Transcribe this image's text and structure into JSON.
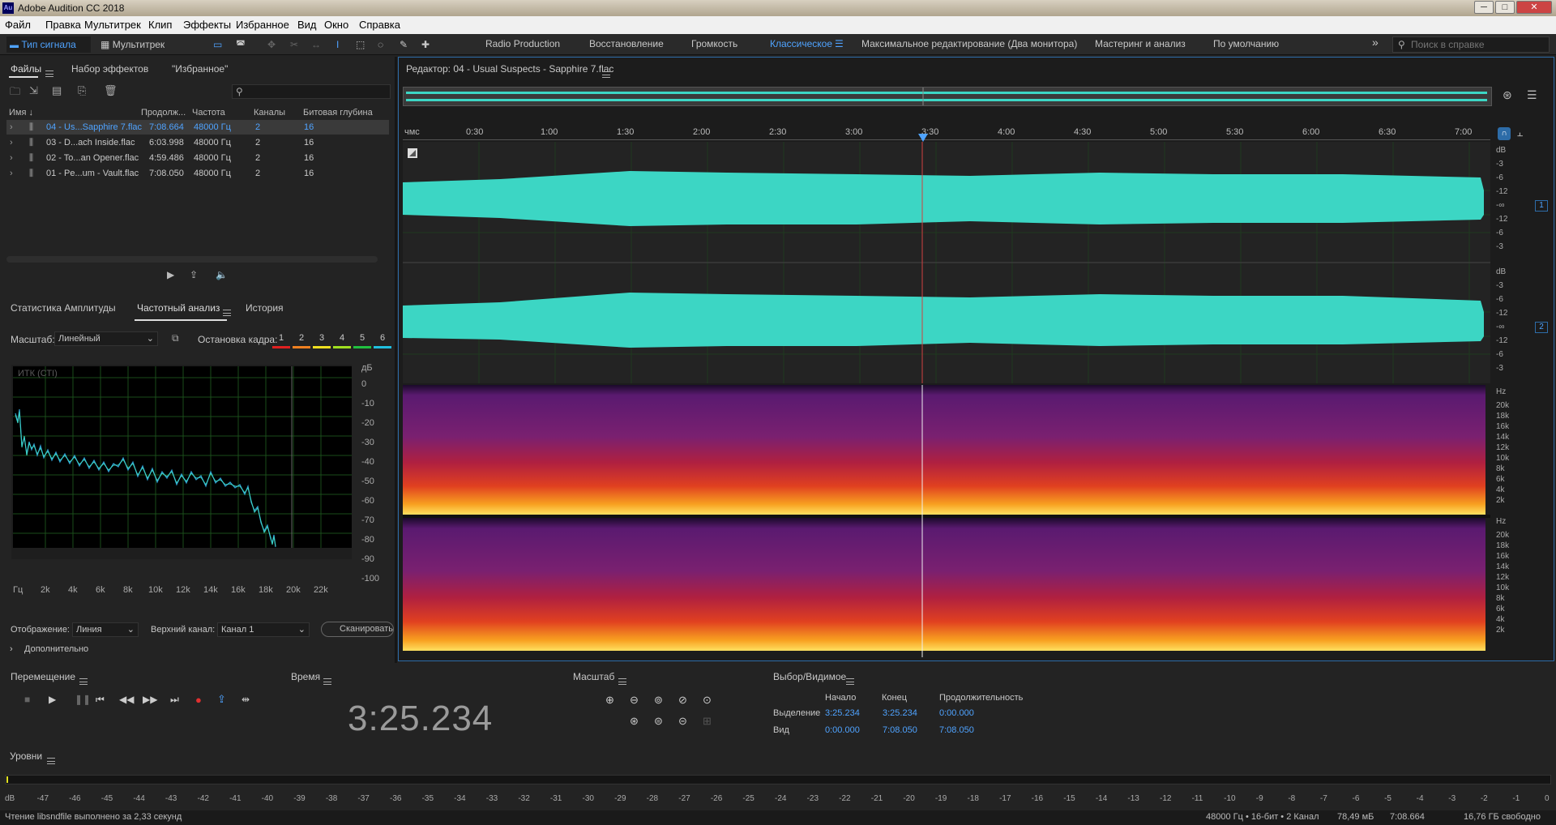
{
  "app": {
    "title": "Adobe Audition CC 2018",
    "logo": "Au"
  },
  "window_controls": {
    "minimize": "─",
    "maximize": "□",
    "close": "✕"
  },
  "menu": [
    "Файл",
    "Правка",
    "Мультитрек",
    "Клип",
    "Эффекты",
    "Избранное",
    "Вид",
    "Окно",
    "Справка"
  ],
  "toolbar": {
    "waveform_label": "Тип сигнала",
    "multitrack_label": "Мультитрек",
    "workspaces": [
      "Radio Production",
      "Восстановление",
      "Громкость",
      "Классическое",
      "Максимальное редактирование (Два монитора)",
      "Мастеринг и анализ",
      "По умолчанию"
    ],
    "active_workspace": "Классическое",
    "more": "»",
    "search_placeholder": "Поиск в справке"
  },
  "files_panel": {
    "tabs": [
      "Файлы",
      "Набор эффектов",
      "\"Избранное\""
    ],
    "columns": [
      "Имя ↓",
      "Продолж...",
      "Частота",
      "Каналы",
      "Битовая глубина"
    ],
    "rows": [
      {
        "name": "04 - Us...Sapphire 7.flac",
        "duration": "7:08.664",
        "rate": "48000 Гц",
        "channels": "2",
        "depth": "16",
        "selected": true
      },
      {
        "name": "03 - D...ach Inside.flac",
        "duration": "6:03.998",
        "rate": "48000 Гц",
        "channels": "2",
        "depth": "16",
        "selected": false
      },
      {
        "name": "02 - To...an Opener.flac",
        "duration": "4:59.486",
        "rate": "48000 Гц",
        "channels": "2",
        "depth": "16",
        "selected": false
      },
      {
        "name": "01 - Pe...um - Vault.flac",
        "duration": "7:08.050",
        "rate": "48000 Гц",
        "channels": "2",
        "depth": "16",
        "selected": false
      }
    ]
  },
  "analysis_panel": {
    "tabs": [
      "Статистика Амплитуды",
      "Частотный анализ",
      "История"
    ],
    "scale_label": "Масштаб:",
    "scale_value": "Линейный",
    "hold_label": "Остановка кадра:",
    "hold_buttons": [
      "1",
      "2",
      "3",
      "4",
      "5",
      "6"
    ],
    "hold_colors": [
      "#e02020",
      "#f08020",
      "#f0e020",
      "#a0e020",
      "#20c040",
      "#20c0e0"
    ],
    "chart_label": "ИТК (СТI)",
    "db_unit": "дБ",
    "db_ticks": [
      "0",
      "-10",
      "-20",
      "-30",
      "-40",
      "-50",
      "-60",
      "-70",
      "-80",
      "-90",
      "-100"
    ],
    "freq_ticks": [
      "Гц",
      "2k",
      "4k",
      "6k",
      "8k",
      "10k",
      "12k",
      "14k",
      "16k",
      "18k",
      "20k",
      "22k"
    ],
    "display_label": "Отображение:",
    "display_value": "Линия",
    "channel_label": "Верхний канал:",
    "channel_value": "Канал 1",
    "scan_label": "Сканировать",
    "advanced_label": "Дополнительно"
  },
  "editor": {
    "title": "Редактор: 04 - Usual Suspects - Sapphire 7.flac",
    "ruler_unit": "чмс",
    "ruler_ticks": [
      "0:30",
      "1:00",
      "1:30",
      "2:00",
      "2:30",
      "3:00",
      "3:30",
      "4:00",
      "4:30",
      "5:00",
      "5:30",
      "6:00",
      "6:30",
      "7:00"
    ],
    "db_label": "dB",
    "db_ticks": [
      "-3",
      "-6",
      "-12",
      "-∞",
      "-12",
      "-6",
      "-3"
    ],
    "channel_badges": [
      "1",
      "2"
    ],
    "hz_label": "Hz",
    "hz_ticks": [
      "20k",
      "18k",
      "16k",
      "14k",
      "12k",
      "10k",
      "8k",
      "6k",
      "4k",
      "2k"
    ],
    "waveform_color": "#3cd6c4"
  },
  "transport": {
    "title": "Перемещение",
    "buttons": [
      "stop-icon",
      "play-icon",
      "pause-icon",
      "go-start-icon",
      "rewind-icon",
      "forward-icon",
      "go-end-icon",
      "record-icon",
      "loop-icon",
      "skip-icon"
    ]
  },
  "time": {
    "title": "Время",
    "value": "3:25.234"
  },
  "zoom": {
    "title": "Масштаб"
  },
  "selection": {
    "title": "Выбор/Видимое",
    "col_start": "Начало",
    "col_end": "Конец",
    "col_duration": "Продолжительность",
    "selection_label": "Выделение",
    "sel_start": "3:25.234",
    "sel_end": "3:25.234",
    "sel_duration": "0:00.000",
    "view_label": "Вид",
    "view_start": "0:00.000",
    "view_end": "7:08.050",
    "view_duration": "7:08.050"
  },
  "levels": {
    "title": "Уровни",
    "scale": [
      "dB",
      "-47",
      "-46",
      "-45",
      "-44",
      "-43",
      "-42",
      "-41",
      "-40",
      "-39",
      "-38",
      "-37",
      "-36",
      "-35",
      "-34",
      "-33",
      "-32",
      "-31",
      "-30",
      "-29",
      "-28",
      "-27",
      "-26",
      "-25",
      "-24",
      "-23",
      "-22",
      "-21",
      "-20",
      "-19",
      "-18",
      "-17",
      "-16",
      "-15",
      "-14",
      "-13",
      "-12",
      "-11",
      "-10",
      "-9",
      "-8",
      "-7",
      "-6",
      "-5",
      "-4",
      "-3",
      "-2",
      "-1",
      "0"
    ]
  },
  "status": {
    "message": "Чтение libsndfile выполнено за 2,33 секунд",
    "format": "48000 Гц • 16-бит • 2 Канал",
    "size": "78,49 мБ",
    "duration": "7:08.664",
    "free": "16,76 ГБ свободно"
  }
}
